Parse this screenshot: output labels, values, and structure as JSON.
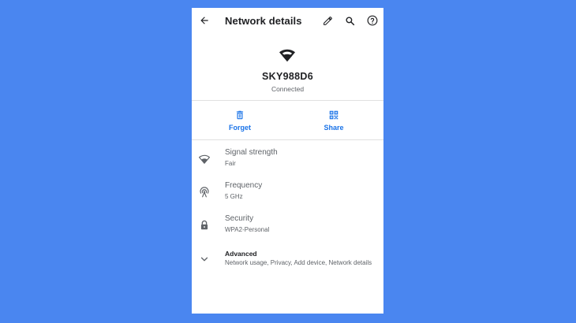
{
  "header": {
    "title": "Network details",
    "back_icon": "arrow-back-icon",
    "edit_icon": "pencil-icon",
    "search_icon": "search-icon",
    "help_icon": "help-icon"
  },
  "network": {
    "ssid": "SKY988D6",
    "status": "Connected",
    "signal_icon": "wifi-icon"
  },
  "actions": [
    {
      "label": "Forget",
      "icon": "trash-icon"
    },
    {
      "label": "Share",
      "icon": "qr-code-icon"
    }
  ],
  "details": [
    {
      "title": "Signal strength",
      "value": "Fair",
      "icon": "wifi-icon"
    },
    {
      "title": "Frequency",
      "value": "5 GHz",
      "icon": "antenna-icon"
    },
    {
      "title": "Security",
      "value": "WPA2-Personal",
      "icon": "lock-icon"
    }
  ],
  "advanced": {
    "title": "Advanced",
    "summary": "Network usage, Privacy, Add device, Network details",
    "icon": "chevron-down-icon"
  },
  "colors": {
    "background": "#4a86f0",
    "accent": "#1a73e8",
    "text_primary": "#202124",
    "text_secondary": "#5f6368"
  }
}
